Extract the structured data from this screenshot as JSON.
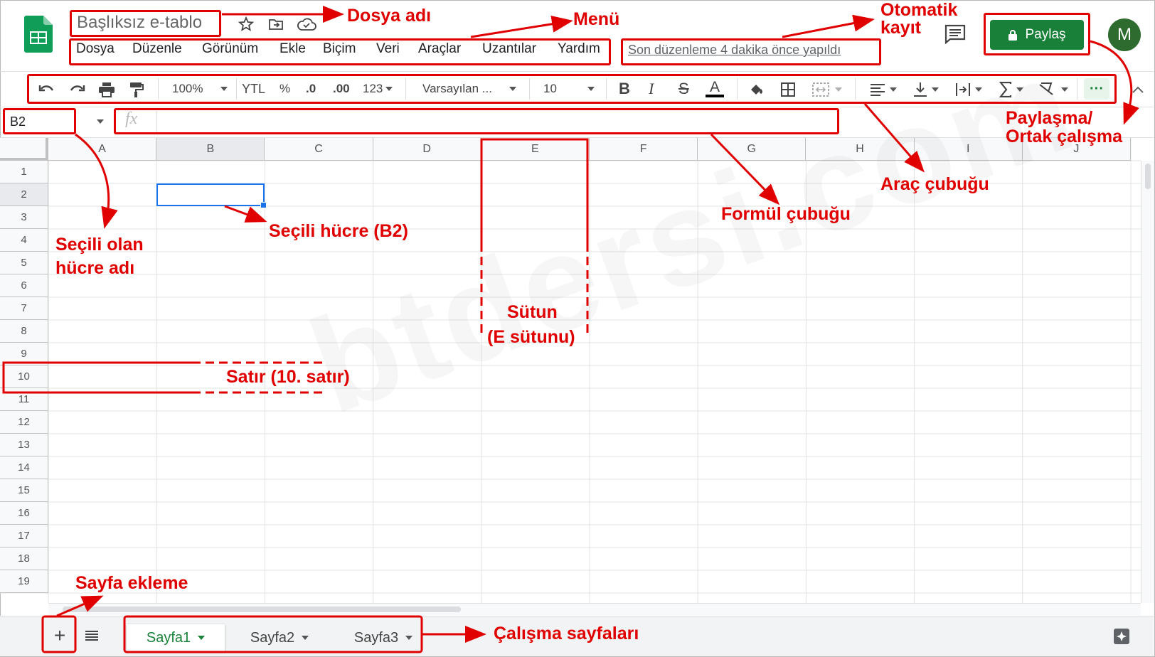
{
  "header": {
    "file_name": "Başlıksız e-tablo",
    "last_edit": "Son düzenleme 4 dakika önce yapıldı",
    "share_label": "Paylaş",
    "avatar_letter": "M"
  },
  "menu": [
    "Dosya",
    "Düzenle",
    "Görünüm",
    "Ekle",
    "Biçim",
    "Veri",
    "Araçlar",
    "Uzantılar",
    "Yardım"
  ],
  "toolbar": {
    "zoom": "100%",
    "currency": "YTL",
    "percent": "%",
    "dec_decrease": ".0",
    "dec_increase": ".00",
    "number_format": "123",
    "font": "Varsayılan ...",
    "font_size": "10",
    "bold": "B",
    "italic": "I",
    "strike": "S",
    "text_color": "A",
    "more": "···"
  },
  "formula_bar": {
    "cell_ref": "B2",
    "fx": "fx"
  },
  "grid": {
    "columns": [
      "A",
      "B",
      "C",
      "D",
      "E",
      "F",
      "G",
      "H",
      "I",
      "J"
    ],
    "rows": [
      "1",
      "2",
      "3",
      "4",
      "5",
      "6",
      "7",
      "8",
      "9",
      "10",
      "11",
      "12",
      "13",
      "14",
      "15",
      "16",
      "17",
      "18",
      "19"
    ],
    "selected_cell": "B2"
  },
  "sheets": {
    "add": "+",
    "tabs": [
      "Sayfa1",
      "Sayfa2",
      "Sayfa3"
    ],
    "active": "Sayfa1"
  },
  "watermark": "btdersi.com",
  "annotations": {
    "dosya_adi": "Dosya adı",
    "menu": "Menü",
    "otomatik_1": "Otomatik",
    "otomatik_2": "kayıt",
    "paylasma_1": "Paylaşma/",
    "paylasma_2": "Ortak çalışma",
    "arac_cubugu": "Araç çubuğu",
    "formul_cubugu": "Formül çubuğu",
    "secili_olan_1": "Seçili olan",
    "secili_olan_2": "hücre adı",
    "secili_hucre": "Seçili hücre (B2)",
    "sutun_1": "Sütun",
    "sutun_2": "(E sütunu)",
    "satir": "Satır (10. satır)",
    "sayfa_ekleme": "Sayfa ekleme",
    "calisma_sayfalari": "Çalışma sayfaları"
  },
  "colors": {
    "accent_green": "#188038",
    "annotation_red": "#e00000",
    "selection_blue": "#1a73e8"
  }
}
